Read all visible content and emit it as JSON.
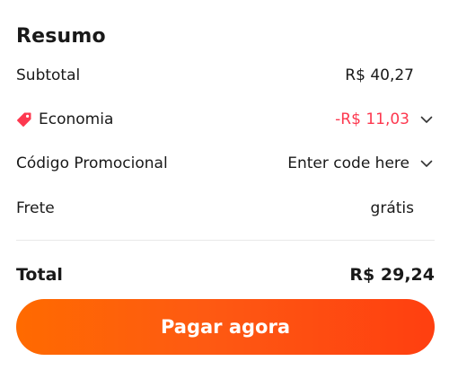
{
  "summary": {
    "title": "Resumo",
    "subtotal": {
      "label": "Subtotal",
      "value": "R$ 40,27"
    },
    "savings": {
      "label": "Economia",
      "value": "-R$ 11,03",
      "icon": "price-tag-icon",
      "color": "#fd384f"
    },
    "promo_code": {
      "label": "Código Promocional",
      "value": "Enter code here"
    },
    "shipping": {
      "label": "Frete",
      "value": "grátis"
    },
    "total": {
      "label": "Total",
      "value": "R$ 29,24"
    },
    "pay_button_label": "Pagar agora",
    "accent_colors": [
      "#ff6a00",
      "#ff3f10"
    ]
  }
}
